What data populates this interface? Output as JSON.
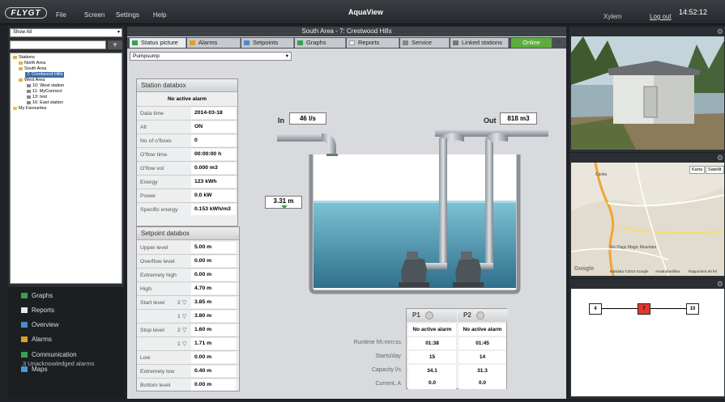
{
  "app": {
    "logo": "FLYGT",
    "title": "AquaView",
    "menu": [
      "File",
      "Screen",
      "Settings",
      "Help"
    ],
    "company": "Xylem",
    "logout": "Log out",
    "clock": "14:52:12"
  },
  "left": {
    "filter_select": "Show All",
    "tree": [
      {
        "label": "Stations",
        "depth": 0
      },
      {
        "label": "North Area",
        "depth": 1
      },
      {
        "label": "South Area",
        "depth": 1
      },
      {
        "label": "7: Crestwood Hills",
        "depth": 2,
        "selected": true
      },
      {
        "label": "West Area",
        "depth": 1
      },
      {
        "label": "10: West station",
        "depth": 2
      },
      {
        "label": "11: MyConnect",
        "depth": 2
      },
      {
        "label": "13: test",
        "depth": 2
      },
      {
        "label": "16: East station",
        "depth": 2
      },
      {
        "label": "My Favourites",
        "depth": 0
      }
    ],
    "nav": [
      {
        "label": "Graphs",
        "icon": "graph-icon",
        "color": "#3aa050"
      },
      {
        "label": "Reports",
        "icon": "report-icon",
        "color": "#e8e8e8"
      },
      {
        "label": "Overview",
        "icon": "overview-icon",
        "color": "#4a8ad0"
      },
      {
        "label": "Alarms",
        "icon": "alarm-bell-icon",
        "color": "#e0a020"
      },
      {
        "label": "Communication",
        "icon": "communication-icon",
        "color": "#3aa050"
      },
      {
        "label": "Maps",
        "icon": "map-icon",
        "color": "#4a9ad0"
      }
    ],
    "unacknowledged": "3 Unacknowledged alarms"
  },
  "center": {
    "breadcrumb": "South Area - 7: Crestwood Hills",
    "tabs": [
      "Status picture",
      "Alarms",
      "Setpoints",
      "Graphs",
      "Reports",
      "Service",
      "Linked stations"
    ],
    "status": "Online",
    "pump_select": "Pumpsump",
    "station_db": {
      "title": "Station databox",
      "alarm": "No active alarm",
      "rows": [
        {
          "label": "Data time",
          "value": "2014-03-18 18:16:20"
        },
        {
          "label": "Alt",
          "value": "ON"
        },
        {
          "label": "No of o'flows",
          "value": "0"
        },
        {
          "label": "O'flow time",
          "value": "00:00:00  h"
        },
        {
          "label": "O'flow vol",
          "value": "0.000  m3"
        },
        {
          "label": "Energy",
          "value": "123 kWh"
        },
        {
          "label": "Power",
          "value": "0.0  kW"
        },
        {
          "label": "Specific energy",
          "value": "0.153 kWh/m3"
        }
      ]
    },
    "setpoint_db": {
      "title": "Setpoint databox",
      "rows": [
        {
          "label": "Upper level",
          "num": "",
          "value": "5.00  m"
        },
        {
          "label": "Overflow level",
          "num": "",
          "value": "0.00  m"
        },
        {
          "label": "Extremely high",
          "num": "",
          "value": "0.00  m"
        },
        {
          "label": "High",
          "num": "",
          "value": "4.70  m"
        },
        {
          "label": "Start level",
          "num": "2",
          "value": "3.85  m"
        },
        {
          "label": "",
          "num": "1",
          "value": "3.80  m"
        },
        {
          "label": "Stop level",
          "num": "2",
          "value": "1.60  m"
        },
        {
          "label": "",
          "num": "1",
          "value": "1.71  m"
        },
        {
          "label": "Low",
          "num": "",
          "value": "0.00  m"
        },
        {
          "label": "Extremely low",
          "num": "",
          "value": "0.40  m"
        },
        {
          "label": "Bottom level",
          "num": "",
          "value": "0.00  m"
        }
      ]
    },
    "inflow": {
      "label": "In",
      "value": "46 l/s"
    },
    "outflow": {
      "label": "Out",
      "value": "818 m3"
    },
    "level": "3.31 m",
    "pumps": {
      "headers": [
        "P1",
        "P2"
      ],
      "alarm": [
        "No active alarm",
        "No active alarm"
      ],
      "rows": [
        {
          "label": "Runtime hh:mm:ss",
          "p1": "01:38",
          "p2": "01:45"
        },
        {
          "label": "Starts/day",
          "p1": "15",
          "p2": "14"
        },
        {
          "label": "Capacity l/s",
          "p1": "34.1",
          "p2": "31.3"
        },
        {
          "label": "Current, A",
          "p1": "0.0",
          "p2": "0.0"
        }
      ]
    }
  },
  "right": {
    "map": {
      "btn1": "Karta",
      "btn2": "Satellit",
      "places": [
        "Casita",
        "Six Flags Magic Mountain"
      ],
      "footer": "Kartdata ©2014 Google",
      "google": "Google",
      "terms": "Användarvillkor",
      "report": "Rapportera ett fel"
    },
    "flow": {
      "nodes": [
        "4",
        "7",
        "10"
      ]
    }
  },
  "colors": {
    "online": "#5cae3a",
    "active_node": "#e23a2e",
    "water": "#3f8fa9"
  }
}
